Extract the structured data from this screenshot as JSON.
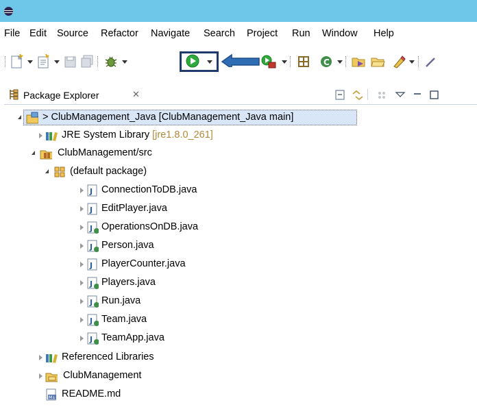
{
  "menu": [
    "File",
    "Edit",
    "Source",
    "Refactor",
    "Navigate",
    "Search",
    "Project",
    "Run",
    "Window",
    "Help"
  ],
  "toolbar": {
    "icons": [
      "new-icon",
      "new-java-icon",
      "save-icon",
      "save-all-icon",
      "debug-icon",
      "run-icon",
      "arrow-annotation-icon",
      "run-external-icon",
      "open-type-icon",
      "new-java-class-icon",
      "open-folder-icon",
      "open-perspective-icon",
      "marker-icon",
      "search-icon"
    ]
  },
  "view": {
    "tab_title": "Package Explorer",
    "close_glyph": "✕",
    "toolbar_icons": [
      "collapse-all-icon",
      "link-with-editor-icon",
      "focus-icon",
      "view-menu-icon",
      "minimize-icon",
      "maximize-icon"
    ]
  },
  "tree": {
    "project": {
      "prefix": "> ",
      "name": "ClubManagement_Java",
      "decoration": " [ClubManagement_Java main]"
    },
    "jre": {
      "name": "JRE System Library",
      "decoration": " [jre1.8.0_261]"
    },
    "src_folder": "ClubManagement/src",
    "default_package": "(default package)",
    "files": [
      "ConnectionToDB.java",
      "EditPlayer.java",
      "OperationsOnDB.java",
      "Person.java",
      "PlayerCounter.java",
      "Players.java",
      "Run.java",
      "Team.java",
      "TeamApp.java"
    ],
    "referenced_libraries": "Referenced Libraries",
    "folder": "ClubManagement",
    "readme": "README.md"
  },
  "colors": {
    "titlebar": "#6ec6e8",
    "run_green": "#2eaa3c",
    "highlight_border": "#1f3b6e",
    "arrow_blue": "#2f6db5",
    "decoration": "#b08a3a",
    "selection": "#d9e6f7"
  }
}
